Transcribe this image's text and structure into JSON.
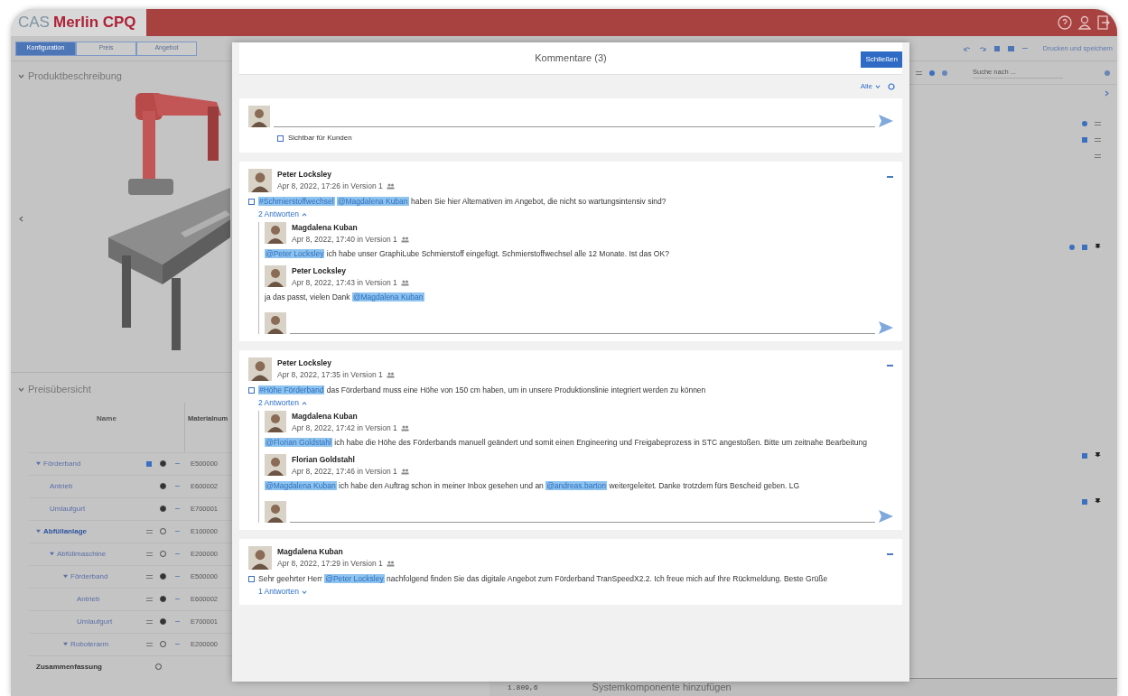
{
  "app": {
    "logo": {
      "prefix": "CAS",
      "name": "Merlin CPQ"
    },
    "tabs": [
      {
        "label": "Konfiguration",
        "selected": true
      },
      {
        "label": "Preis",
        "selected": false
      },
      {
        "label": "Angebot",
        "selected": false
      }
    ],
    "print_button": "Drucken und speichern",
    "search": {
      "placeholder": "Suche nach ..."
    },
    "product_section": {
      "title": "Produktbeschreibung",
      "expanded": true
    },
    "price_section": {
      "title": "Preisübersicht",
      "expanded": true,
      "columns": [
        "Name",
        "Materialnum"
      ],
      "rows": [
        {
          "name": "Förderband",
          "material": "E500000",
          "kind": "commented",
          "done": true,
          "expanded": true,
          "children": [
            {
              "name": "Antrieb",
              "material": "E600002",
              "kind": "standard",
              "done": true
            },
            {
              "name": "Umlaufgurt",
              "material": "E700001",
              "kind": "standard",
              "done": true
            }
          ]
        },
        {
          "name": "Abfüllanlage",
          "material": "E100000",
          "kind": "configurable",
          "done": false,
          "expanded": true,
          "emphasized": true,
          "children": [
            {
              "name": "Abfüllmaschine",
              "material": "E200000",
              "kind": "configurable",
              "done": false,
              "expanded": true,
              "children": [
                {
                  "name": "Förderband",
                  "material": "E500000",
                  "kind": "configurable",
                  "done": true,
                  "expanded": true,
                  "children": [
                    {
                      "name": "Antrieb",
                      "material": "E600002",
                      "kind": "configurable",
                      "done": true
                    },
                    {
                      "name": "Umlaufgurt",
                      "material": "E700001",
                      "kind": "configurable",
                      "done": true
                    }
                  ]
                },
                {
                  "name": "Roboterarm",
                  "material": "E200000",
                  "kind": "configurable",
                  "done": false,
                  "expanded": true
                }
              ]
            }
          ]
        }
      ],
      "summary": {
        "label": "Zusammenfassung",
        "total": "1.809,6"
      }
    },
    "add_component": "Systemkomponente hinzufügen"
  },
  "comments_dialog": {
    "title": "Kommentare (3)",
    "close": "Schließen",
    "filter": "Alle",
    "composer": {
      "visible_to_customers": {
        "label": "Sichtbar für Kunden",
        "checked": false
      }
    },
    "comments": [
      {
        "author": "Peter Locksley",
        "meta": "Apr 8, 2022, 17:26 in Version 1",
        "parts": [
          {
            "kind": "mention",
            "text": "#Schmierstoffwechsel"
          },
          {
            "kind": "mention",
            "text": "@Magdalena Kuban"
          },
          {
            "kind": "plain",
            "text": "haben Sie hier Alternativen im Angebot, die nicht so wartungsintensiv sind?"
          }
        ],
        "replies_toggle": "2 Antworten",
        "expanded": true,
        "replies": [
          {
            "author": "Magdalena Kuban",
            "meta": "Apr 8, 2022, 17:40 in Version 1",
            "parts": [
              {
                "kind": "mention",
                "text": "@Peter Locksley"
              },
              {
                "kind": "plain",
                "text": "ich habe unser GraphiLube Schmierstoff eingefügt. Schmierstoffwechsel alle 12 Monate. Ist das OK?"
              }
            ]
          },
          {
            "author": "Peter Locksley",
            "meta": "Apr 8, 2022, 17:43 in Version 1",
            "parts": [
              {
                "kind": "plain",
                "text": "ja das passt, vielen Dank"
              },
              {
                "kind": "mention",
                "text": "@Magdalena Kuban"
              }
            ]
          }
        ]
      },
      {
        "author": "Peter Locksley",
        "meta": "Apr 8, 2022, 17:35 in Version 1",
        "parts": [
          {
            "kind": "mention",
            "text": "#Höhe Förderband"
          },
          {
            "kind": "plain",
            "text": "das Förderband muss eine Höhe von 150 cm haben, um in unsere Produktionslinie integriert werden zu können"
          }
        ],
        "replies_toggle": "2 Antworten",
        "expanded": true,
        "replies": [
          {
            "author": "Magdalena Kuban",
            "meta": "Apr 8, 2022, 17:42 in Version 1",
            "parts": [
              {
                "kind": "mention",
                "text": "@Florian Goldstahl"
              },
              {
                "kind": "plain",
                "text": "ich habe die Höhe des Förderbands manuell geändert und somit einen Engineering und Freigabeprozess in STC angestoßen. Bitte um zeitnahe Bearbeitung"
              }
            ]
          },
          {
            "author": "Florian Goldstahl",
            "meta": "Apr 8, 2022, 17:46 in Version 1",
            "parts": [
              {
                "kind": "mention",
                "text": "@Magdalena Kuban"
              },
              {
                "kind": "plain",
                "text": "ich habe den Auftrag schon in meiner Inbox gesehen und an"
              },
              {
                "kind": "mention",
                "text": "@andreas.barton"
              },
              {
                "kind": "plain",
                "text": "weitergeleitet. Danke trotzdem fürs Bescheid geben. LG"
              }
            ]
          }
        ]
      },
      {
        "author": "Magdalena Kuban",
        "meta": "Apr 8, 2022, 17:29 in Version 1",
        "parts": [
          {
            "kind": "plain",
            "text": "Sehr geehrter Herr"
          },
          {
            "kind": "mention",
            "text": "@Peter Locksley"
          },
          {
            "kind": "plain",
            "text": "nachfolgend finden Sie das digitale Angebot zum Förderband TranSpeedX2.2. Ich freue mich auf Ihre Rückmeldung. Beste Grüße"
          }
        ],
        "replies_toggle": "1 Antworten",
        "expanded": false
      }
    ]
  }
}
